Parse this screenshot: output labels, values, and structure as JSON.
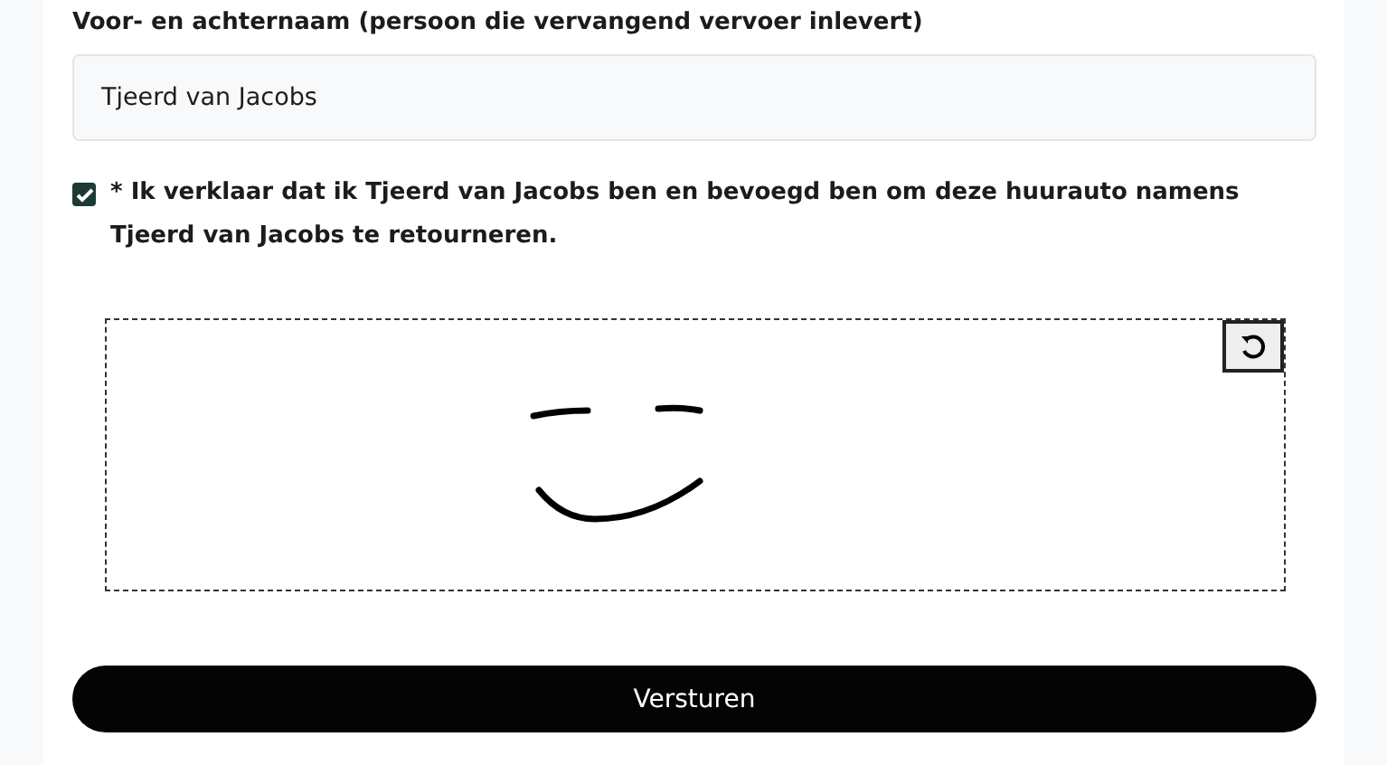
{
  "name_field": {
    "label": "Voor- en achternaam (persoon die vervangend vervoer inlevert)",
    "value": "Tjeerd van Jacobs"
  },
  "declaration": {
    "checked": true,
    "text": "* Ik verklaar dat ik Tjeerd van Jacobs ben en bevoegd ben om deze huurauto namens Tjeerd van Jacobs te retourneren."
  },
  "signature": {
    "signed": true
  },
  "submit_button": {
    "label": "Versturen"
  }
}
